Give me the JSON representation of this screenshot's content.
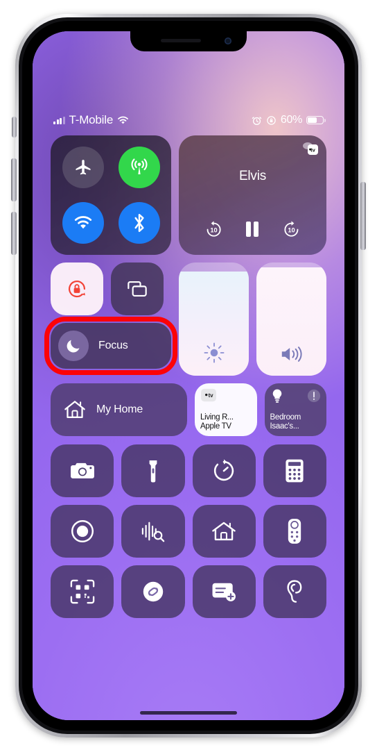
{
  "device": {
    "name": "iPhone",
    "frame_color": "#c9c9cf"
  },
  "status_bar": {
    "signal_icon": "cellular-bars-icon",
    "carrier": "T-Mobile",
    "wifi_icon": "wifi-icon",
    "alarm_icon": "alarm-clock-icon",
    "rotation_lock_icon": "rotation-lock-icon",
    "battery_percent": "60%",
    "battery_level": 60,
    "battery_icon": "battery-icon"
  },
  "control_center": {
    "connectivity": {
      "airplane": {
        "name": "airplane-mode-button",
        "icon": "airplane-icon",
        "state": "off"
      },
      "cellular": {
        "name": "cellular-data-button",
        "icon": "cellular-antenna-icon",
        "state": "on",
        "color": "#32d74b"
      },
      "wifi": {
        "name": "wifi-button",
        "icon": "wifi-icon",
        "state": "on",
        "color": "#1b7cf5"
      },
      "bluetooth": {
        "name": "bluetooth-button",
        "icon": "bluetooth-icon",
        "state": "on",
        "color": "#1b7cf5"
      }
    },
    "media": {
      "title": "Elvis",
      "airplay_badge": "apple-tv-icon",
      "skip_back_label": "10",
      "skip_forward_label": "10",
      "playback_state": "playing",
      "play_pause_icon": "pause-icon",
      "rewind_icon": "skip-back-10-icon",
      "forward_icon": "skip-forward-10-icon"
    },
    "rotation_lock": {
      "label": "Rotation Lock",
      "icon": "rotation-lock-icon",
      "state": "on",
      "color": "#f24236"
    },
    "screen_mirroring": {
      "label": "Screen Mirroring",
      "icon": "screen-mirroring-icon",
      "state": "off"
    },
    "focus": {
      "label": "Focus",
      "icon": "moon-icon",
      "state": "off",
      "highlighted": true
    },
    "brightness": {
      "label": "Brightness",
      "icon": "brightness-icon",
      "value": 92
    },
    "volume": {
      "label": "Volume",
      "icon": "speaker-waves-icon",
      "value": 96
    },
    "home": {
      "my_home": {
        "label": "My Home",
        "icon": "home-icon"
      },
      "accessory_1": {
        "line1": "Living R...",
        "line2": "Apple TV",
        "icon": "apple-tv-icon",
        "state": "on"
      },
      "accessory_2": {
        "line1": "Bedroom",
        "line2": "Isaac's...",
        "icon": "lightbulb-icon",
        "badge": "warning-icon",
        "state": "off"
      }
    },
    "shortcuts": [
      {
        "name": "camera-button",
        "icon": "camera-icon"
      },
      {
        "name": "flashlight-button",
        "icon": "flashlight-icon"
      },
      {
        "name": "timer-button",
        "icon": "timer-icon"
      },
      {
        "name": "calculator-button",
        "icon": "calculator-icon"
      },
      {
        "name": "screen-record-button",
        "icon": "screen-record-icon"
      },
      {
        "name": "sound-recognition-button",
        "icon": "sound-recognition-icon"
      },
      {
        "name": "home-button",
        "icon": "home-icon"
      },
      {
        "name": "apple-tv-remote-button",
        "icon": "remote-icon"
      },
      {
        "name": "qr-scanner-button",
        "icon": "qr-code-icon"
      },
      {
        "name": "shazam-button",
        "icon": "shazam-icon"
      },
      {
        "name": "notes-button",
        "icon": "note-add-icon"
      },
      {
        "name": "hearing-button",
        "icon": "ear-icon"
      }
    ]
  },
  "annotation": {
    "type": "highlight-rectangle",
    "target": "Focus",
    "color": "#fc0307"
  }
}
